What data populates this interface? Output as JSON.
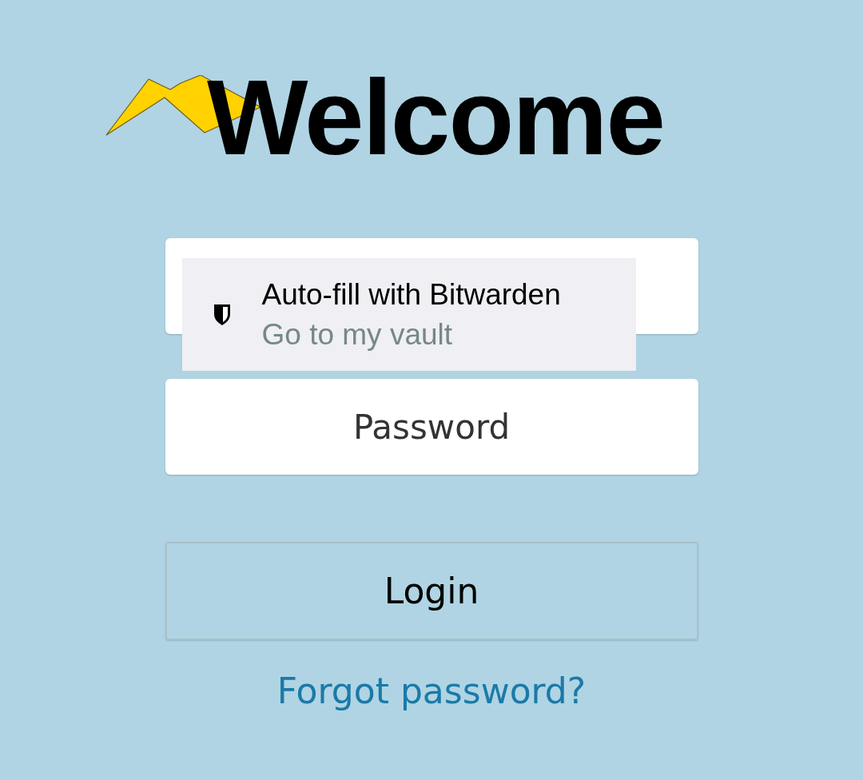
{
  "title": "Welcome",
  "username_field": {
    "autofill_popup": {
      "title": "Auto-fill with Bitwarden",
      "subtitle": "Go to my vault"
    }
  },
  "password_field": {
    "placeholder": "Password"
  },
  "login_button": "Login",
  "forgot_link": "Forgot password?"
}
